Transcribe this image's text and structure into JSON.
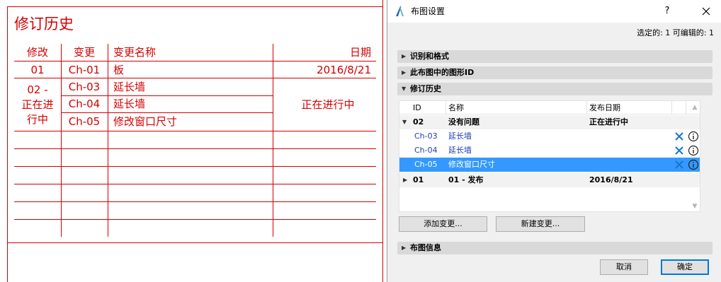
{
  "drawing": {
    "title": "修订历史",
    "headers": {
      "rev": "修改",
      "change": "变更",
      "name": "变更名称",
      "date": "日期"
    },
    "rows": [
      {
        "rev": "01",
        "change": "Ch-01",
        "name": "板",
        "date": "2016/8/21"
      },
      {
        "rev_line1": "02 -",
        "rev_line2": "正在进",
        "rev_line3": "行中",
        "date": "正在进行中"
      }
    ],
    "group2": [
      {
        "change": "Ch-03",
        "name": "延长墙"
      },
      {
        "change": "Ch-04",
        "name": "延长墙"
      },
      {
        "change": "Ch-05",
        "name": "修改窗口尺寸"
      }
    ],
    "color": "#d40000"
  },
  "dialog": {
    "title": "布图设置",
    "help": "?",
    "selection_info": "选定的: 1 可编辑的: 1",
    "sections": {
      "id_format": "识别和格式",
      "drawing_id": "此布图中的图形ID",
      "revision_history": "修订历史",
      "layout_info": "布图信息"
    },
    "list": {
      "columns": {
        "id": "ID",
        "name": "名称",
        "date": "发布日期"
      },
      "groups": [
        {
          "id": "02",
          "name": "没有问题",
          "date": "正在进行中"
        },
        {
          "id": "01",
          "name": "01 - 发布",
          "date": "2016/8/21"
        }
      ],
      "items": [
        {
          "id": "Ch-03",
          "name": "延长墙"
        },
        {
          "id": "Ch-04",
          "name": "延长墙"
        },
        {
          "id": "Ch-05",
          "name": "修改窗口尺寸"
        }
      ]
    },
    "buttons": {
      "add_change": "添加变更...",
      "new_change": "新建变更...",
      "cancel": "取消",
      "ok": "确定"
    },
    "colors": {
      "selection": "#3399ff",
      "link_text": "#1f3fb8",
      "accent": "#0078d7"
    }
  }
}
